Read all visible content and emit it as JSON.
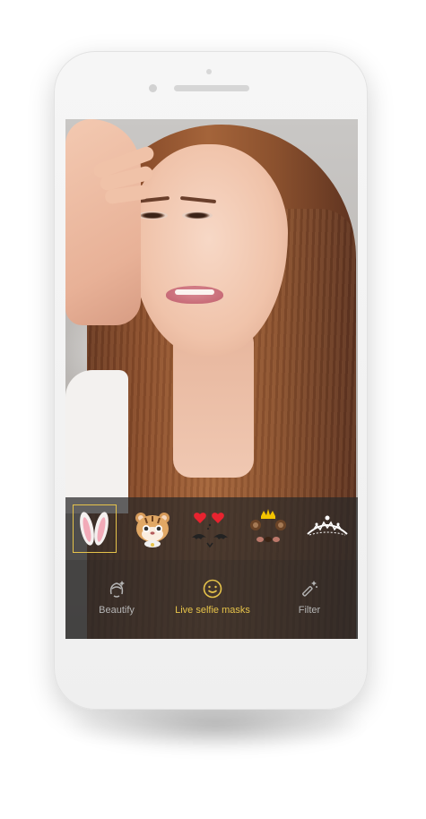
{
  "mask_strip": {
    "items": [
      {
        "icon": "bunny-ears-icon",
        "selected": true
      },
      {
        "icon": "tiger-face-icon",
        "selected": false
      },
      {
        "icon": "devil-hearts-icon",
        "selected": false
      },
      {
        "icon": "bear-crown-icon",
        "selected": false
      },
      {
        "icon": "tiara-icon",
        "selected": false
      }
    ]
  },
  "tabs": {
    "beautify": {
      "label": "Beautify",
      "icon": "face-sparkle-icon"
    },
    "masks": {
      "label": "Live selfie masks",
      "icon": "smiley-icon",
      "active": true
    },
    "filter": {
      "label": "Filter",
      "icon": "magic-wand-icon"
    }
  },
  "colors": {
    "accent": "#E6C34A",
    "tab_inactive": "#B5B5B5",
    "panel": "#282828"
  }
}
